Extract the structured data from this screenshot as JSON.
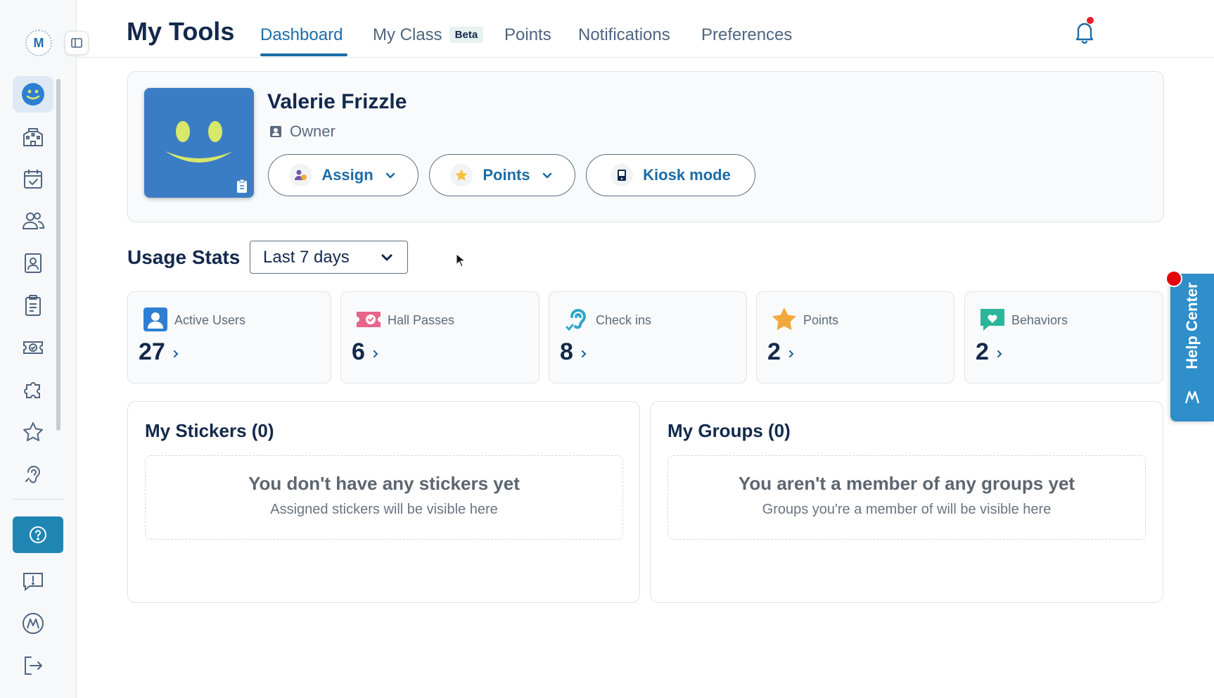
{
  "header": {
    "title": "My Tools",
    "tabs": [
      {
        "label": "Dashboard",
        "active": true
      },
      {
        "label": "My Class",
        "badge": "Beta"
      },
      {
        "label": "Points"
      },
      {
        "label": "Notifications"
      },
      {
        "label": "Preferences"
      }
    ]
  },
  "sidebar": {
    "logo_letter": "M",
    "items": [
      {
        "icon": "smiley-icon",
        "active": true
      },
      {
        "icon": "school-icon"
      },
      {
        "icon": "calendar-check-icon"
      },
      {
        "icon": "users-icon"
      },
      {
        "icon": "id-card-icon"
      },
      {
        "icon": "clipboard-icon"
      },
      {
        "icon": "ticket-icon"
      },
      {
        "icon": "puzzle-icon"
      },
      {
        "icon": "star-icon"
      },
      {
        "icon": "ear-icon"
      }
    ],
    "bottom_items": [
      {
        "icon": "help-icon"
      },
      {
        "icon": "feedback-icon"
      },
      {
        "icon": "brand-logo-icon"
      },
      {
        "icon": "logout-icon"
      }
    ]
  },
  "profile": {
    "name": "Valerie Frizzle",
    "role": "Owner",
    "actions": {
      "assign": "Assign",
      "points": "Points",
      "kiosk": "Kiosk mode"
    }
  },
  "usage": {
    "title": "Usage Stats",
    "range": "Last 7 days",
    "stats": [
      {
        "label": "Active Users",
        "value": "27",
        "icon": "user-card-icon",
        "color": "#2d7fd3"
      },
      {
        "label": "Hall Passes",
        "value": "6",
        "icon": "hall-pass-icon",
        "color": "#e8648b"
      },
      {
        "label": "Check ins",
        "value": "8",
        "icon": "ear-check-icon",
        "color": "#2fa8c6"
      },
      {
        "label": "Points",
        "value": "2",
        "icon": "star-icon",
        "color": "#f2a93b"
      },
      {
        "label": "Behaviors",
        "value": "2",
        "icon": "heart-chat-icon",
        "color": "#2bb59a"
      }
    ]
  },
  "stickers": {
    "title": "My Stickers (0)",
    "empty_title": "You don't have any stickers yet",
    "empty_sub": "Assigned stickers will be visible here"
  },
  "groups": {
    "title": "My Groups (0)",
    "empty_title": "You aren't a member of any groups yet",
    "empty_sub": "Groups you're a member of will be visible here"
  },
  "help_center": {
    "label": "Help Center"
  },
  "colors": {
    "primary": "#1c6ca8",
    "navy": "#13294b",
    "help_blue": "#2e8fcb",
    "notification_red": "#e3202b"
  }
}
